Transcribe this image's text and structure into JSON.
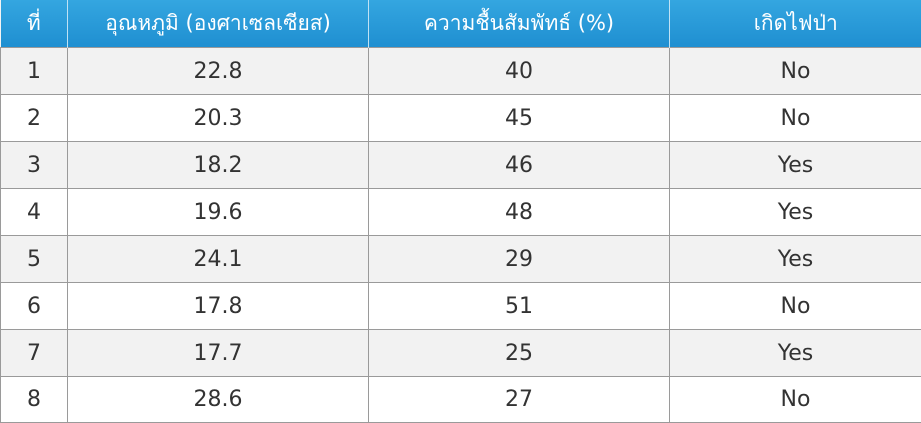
{
  "table": {
    "headers": [
      "ที่",
      "อุณหภูมิ (องศาเซลเซียส)",
      "ความชื้นสัมพัทธ์ (%)",
      "เกิดไฟป่า"
    ],
    "rows": [
      [
        "1",
        "22.8",
        "40",
        "No"
      ],
      [
        "2",
        "20.3",
        "45",
        "No"
      ],
      [
        "3",
        "18.2",
        "46",
        "Yes"
      ],
      [
        "4",
        "19.6",
        "48",
        "Yes"
      ],
      [
        "5",
        "24.1",
        "29",
        "Yes"
      ],
      [
        "6",
        "17.8",
        "51",
        "No"
      ],
      [
        "7",
        "17.7",
        "25",
        "Yes"
      ],
      [
        "8",
        "28.6",
        "27",
        "No"
      ]
    ]
  },
  "colors": {
    "header_background": "#2a9ad8",
    "header_text": "#ffffff",
    "border": "#9a9a9a"
  }
}
